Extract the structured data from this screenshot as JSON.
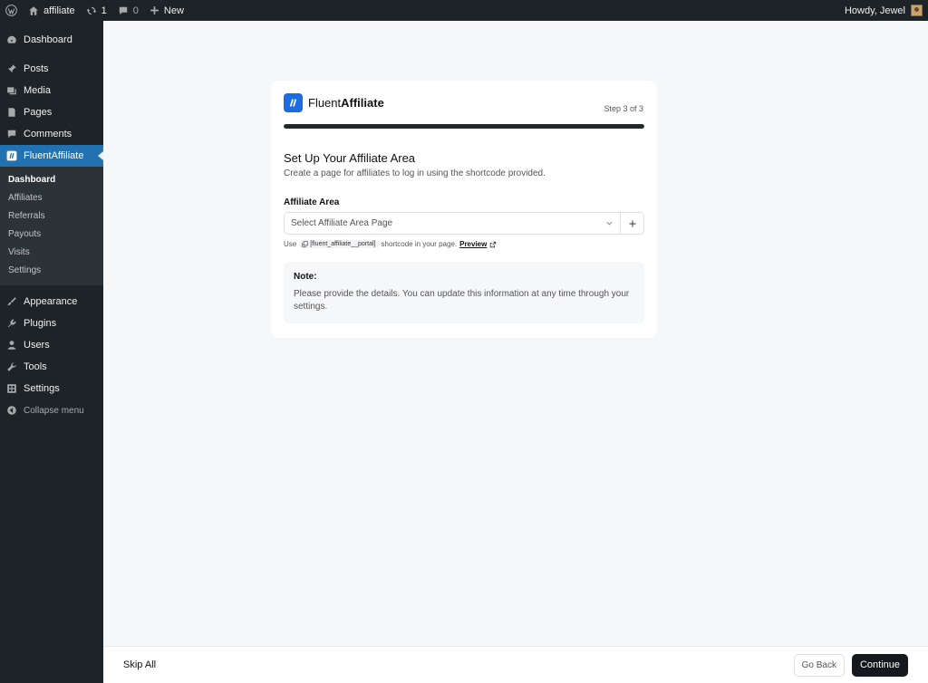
{
  "adminbar": {
    "site_name": "affiliate",
    "updates_count": "1",
    "comments_count": "0",
    "new_label": "New",
    "howdy": "Howdy, Jewel"
  },
  "sidebar": {
    "items_top": [
      {
        "label": "Dashboard",
        "icon": "dashboard-icon"
      }
    ],
    "items_mid": [
      {
        "label": "Posts",
        "icon": "pin-icon"
      },
      {
        "label": "Media",
        "icon": "media-icon"
      },
      {
        "label": "Pages",
        "icon": "pages-icon"
      },
      {
        "label": "Comments",
        "icon": "comment-icon"
      }
    ],
    "active": {
      "label": "FluentAffiliate",
      "icon": "fluentaffiliate-icon"
    },
    "submenu": [
      "Dashboard",
      "Affiliates",
      "Referrals",
      "Payouts",
      "Visits",
      "Settings"
    ],
    "items_bottom": [
      {
        "label": "Appearance",
        "icon": "brush-icon"
      },
      {
        "label": "Plugins",
        "icon": "plugin-icon"
      },
      {
        "label": "Users",
        "icon": "user-icon"
      },
      {
        "label": "Tools",
        "icon": "wrench-icon"
      },
      {
        "label": "Settings",
        "icon": "settings-icon"
      }
    ],
    "collapse_label": "Collapse menu"
  },
  "wizard": {
    "brand_regular": "Fluent",
    "brand_bold": "Affiliate",
    "step_text": "Step 3 of 3",
    "progress": 1.0,
    "title": "Set Up Your Affiliate Area",
    "description": "Create a page for affiliates to log in using the shortcode provided.",
    "field_label": "Affiliate Area",
    "select_placeholder": "Select Affiliate Area Page",
    "hint_prefix": "Use",
    "shortcode": "[fluent_affiliate__portal]",
    "hint_suffix": "shortcode in your page.",
    "preview_label": "Preview",
    "note_title": "Note:",
    "note_text": "Please provide the details. You can update this information at any time through your settings."
  },
  "footer": {
    "skip_label": "Skip All",
    "back_label": "Go Back",
    "continue_label": "Continue"
  },
  "colors": {
    "admin_dark": "#1d2327",
    "accent_blue": "#2271b1",
    "brand_blue": "#1c6be0",
    "continue_bg": "#15191e"
  }
}
